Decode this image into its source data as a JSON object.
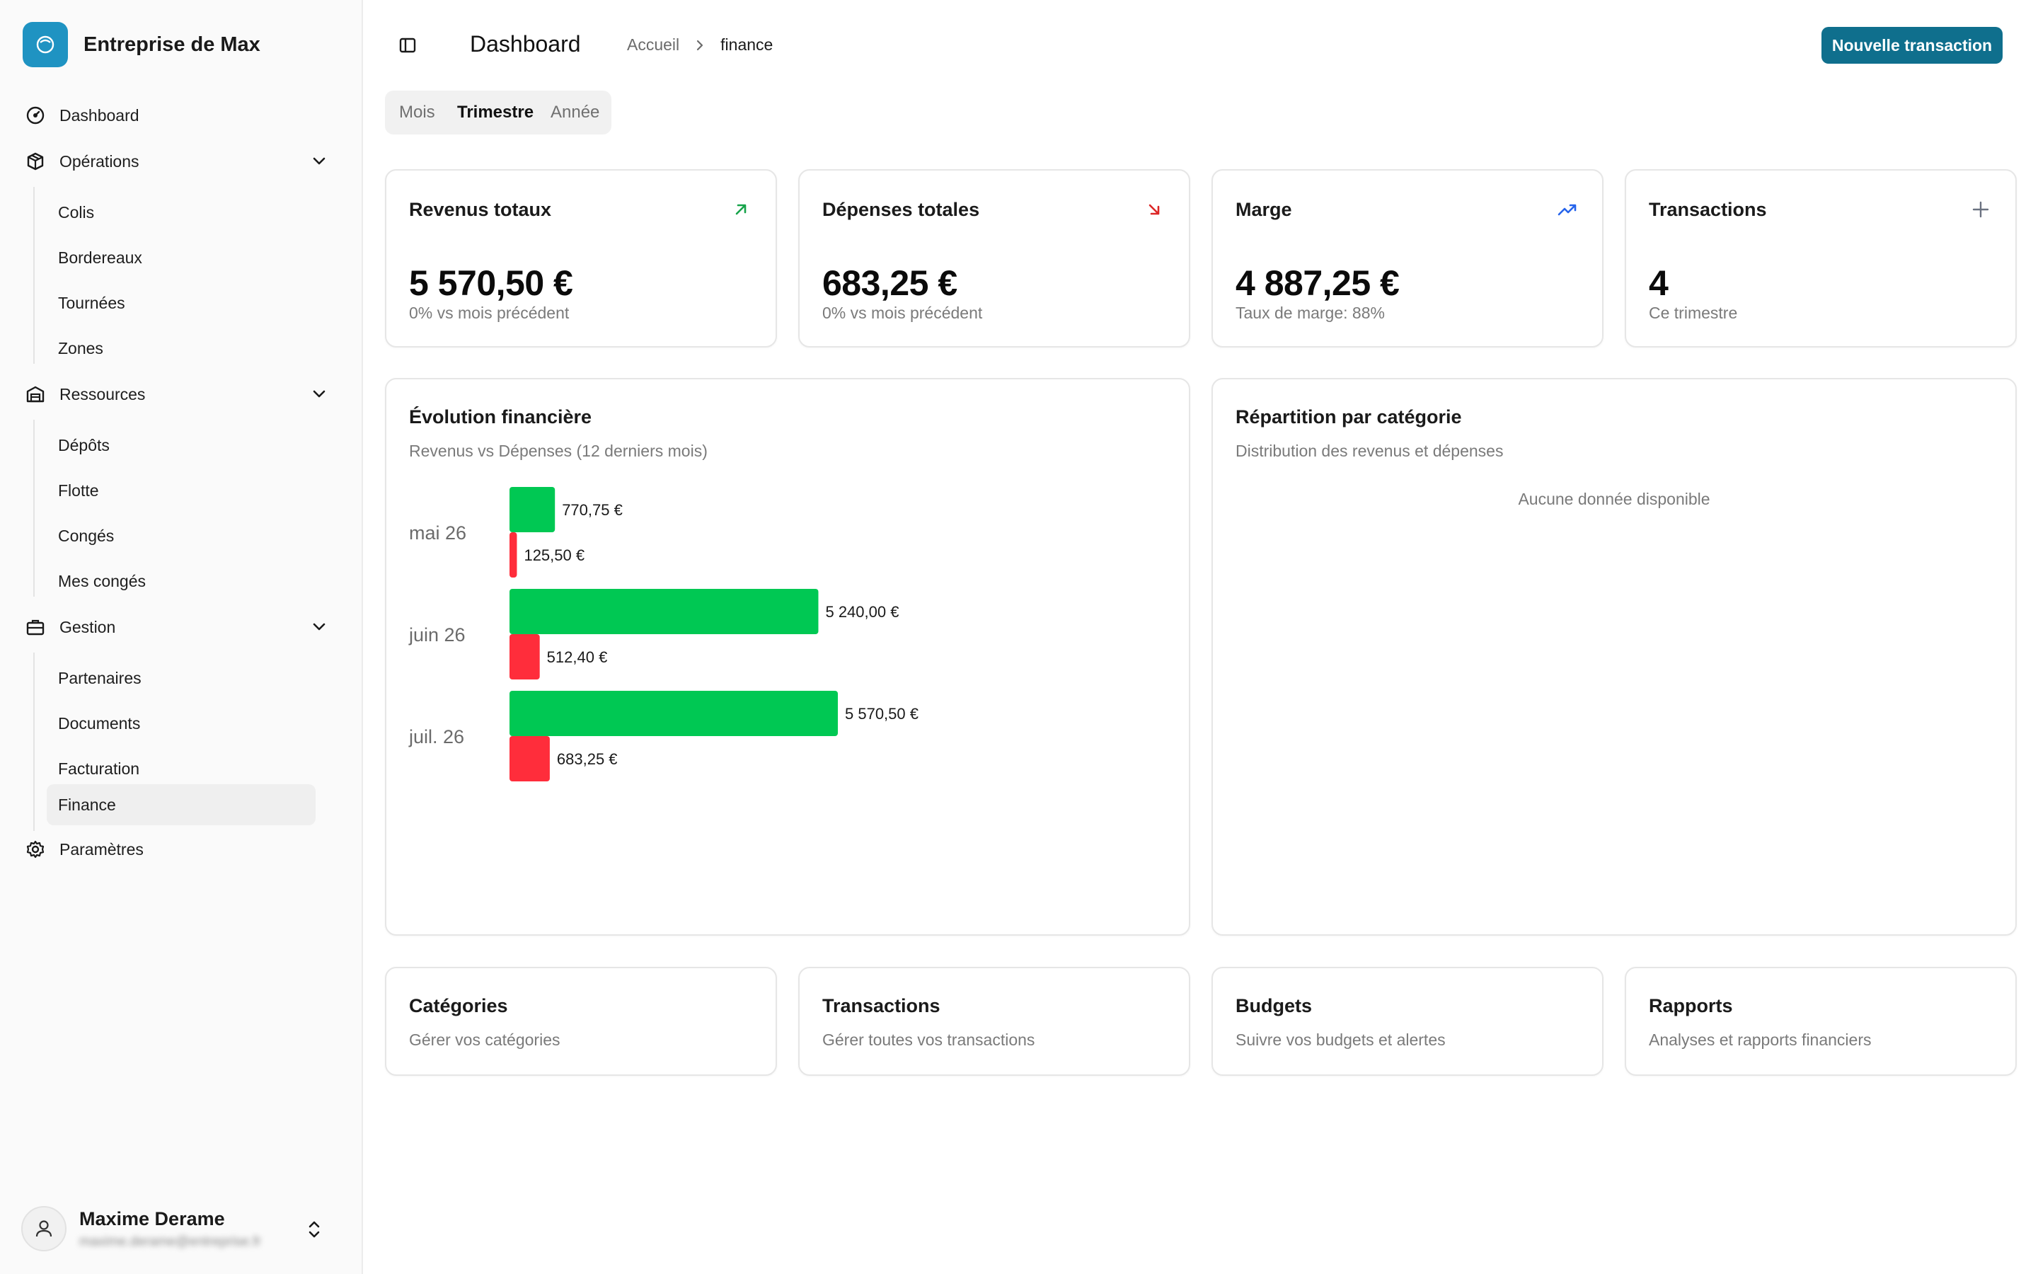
{
  "company": {
    "name": "Entreprise de Max",
    "logo_icon": "circle-logo-icon"
  },
  "sidebar": {
    "items": [
      {
        "label": "Dashboard",
        "icon": "gauge-icon"
      },
      {
        "label": "Opérations",
        "icon": "package-icon",
        "children": [
          "Colis",
          "Bordereaux",
          "Tournées",
          "Zones"
        ]
      },
      {
        "label": "Ressources",
        "icon": "warehouse-icon",
        "children": [
          "Dépôts",
          "Flotte",
          "Congés",
          "Mes congés"
        ]
      },
      {
        "label": "Gestion",
        "icon": "briefcase-icon",
        "children": [
          "Partenaires",
          "Documents",
          "Facturation",
          "Finance"
        ]
      },
      {
        "label": "Paramètres",
        "icon": "gear-icon"
      }
    ],
    "active_item": "Finance"
  },
  "user": {
    "name": "Maxime Derame",
    "email": "maxime.derame@entreprise.fr"
  },
  "header": {
    "title": "Dashboard",
    "breadcrumb": [
      "Accueil",
      "finance"
    ],
    "primary_button": "Nouvelle transaction"
  },
  "period_tabs": {
    "options": [
      "Mois",
      "Trimestre",
      "Année"
    ],
    "selected": "Trimestre"
  },
  "stats": [
    {
      "title": "Revenus totaux",
      "value": "5 570,50 €",
      "subtitle": "0% vs mois précédent",
      "icon": "arrow-up-right-icon",
      "color": "#16a34a"
    },
    {
      "title": "Dépenses totales",
      "value": "683,25 €",
      "subtitle": "0% vs mois précédent",
      "icon": "arrow-down-right-icon",
      "color": "#dc2626"
    },
    {
      "title": "Marge",
      "value": "4 887,25 €",
      "subtitle": "Taux de marge: 88%",
      "icon": "trending-up-icon",
      "color": "#2563eb"
    },
    {
      "title": "Transactions",
      "value": "4",
      "subtitle": "Ce trimestre",
      "icon": "plus-icon",
      "color": "#6b7280"
    }
  ],
  "evolution": {
    "title": "Évolution financière",
    "subtitle": "Revenus vs Dépenses (12 derniers mois)"
  },
  "chart_data": {
    "type": "bar",
    "orientation": "horizontal",
    "categories": [
      "mai 26",
      "juin 26",
      "juil. 26"
    ],
    "series": [
      {
        "values": [
          770.75,
          5240.0,
          5570.5
        ],
        "labels": [
          "770,75 €",
          "5 240,00 €",
          "5 570,50 €"
        ],
        "color": "#00c853"
      },
      {
        "values": [
          125.5,
          512.4,
          683.25
        ],
        "labels": [
          "125,50 €",
          "512,40 €",
          "683,25 €"
        ],
        "color": "#ff2d3b"
      }
    ],
    "xlim": [
      0,
      5570.5
    ]
  },
  "repartition": {
    "title": "Répartition par catégorie",
    "subtitle": "Distribution des revenus et dépenses",
    "empty": "Aucune donnée disponible"
  },
  "links": [
    {
      "title": "Catégories",
      "subtitle": "Gérer vos catégories"
    },
    {
      "title": "Transactions",
      "subtitle": "Gérer toutes vos transactions"
    },
    {
      "title": "Budgets",
      "subtitle": "Suivre vos budgets et alertes"
    },
    {
      "title": "Rapports",
      "subtitle": "Analyses et rapports financiers"
    }
  ],
  "colors": {
    "accent": "#0f6f8d",
    "logo": "#1f93c2",
    "revenue": "#00c853",
    "expense": "#ff2d3b"
  }
}
